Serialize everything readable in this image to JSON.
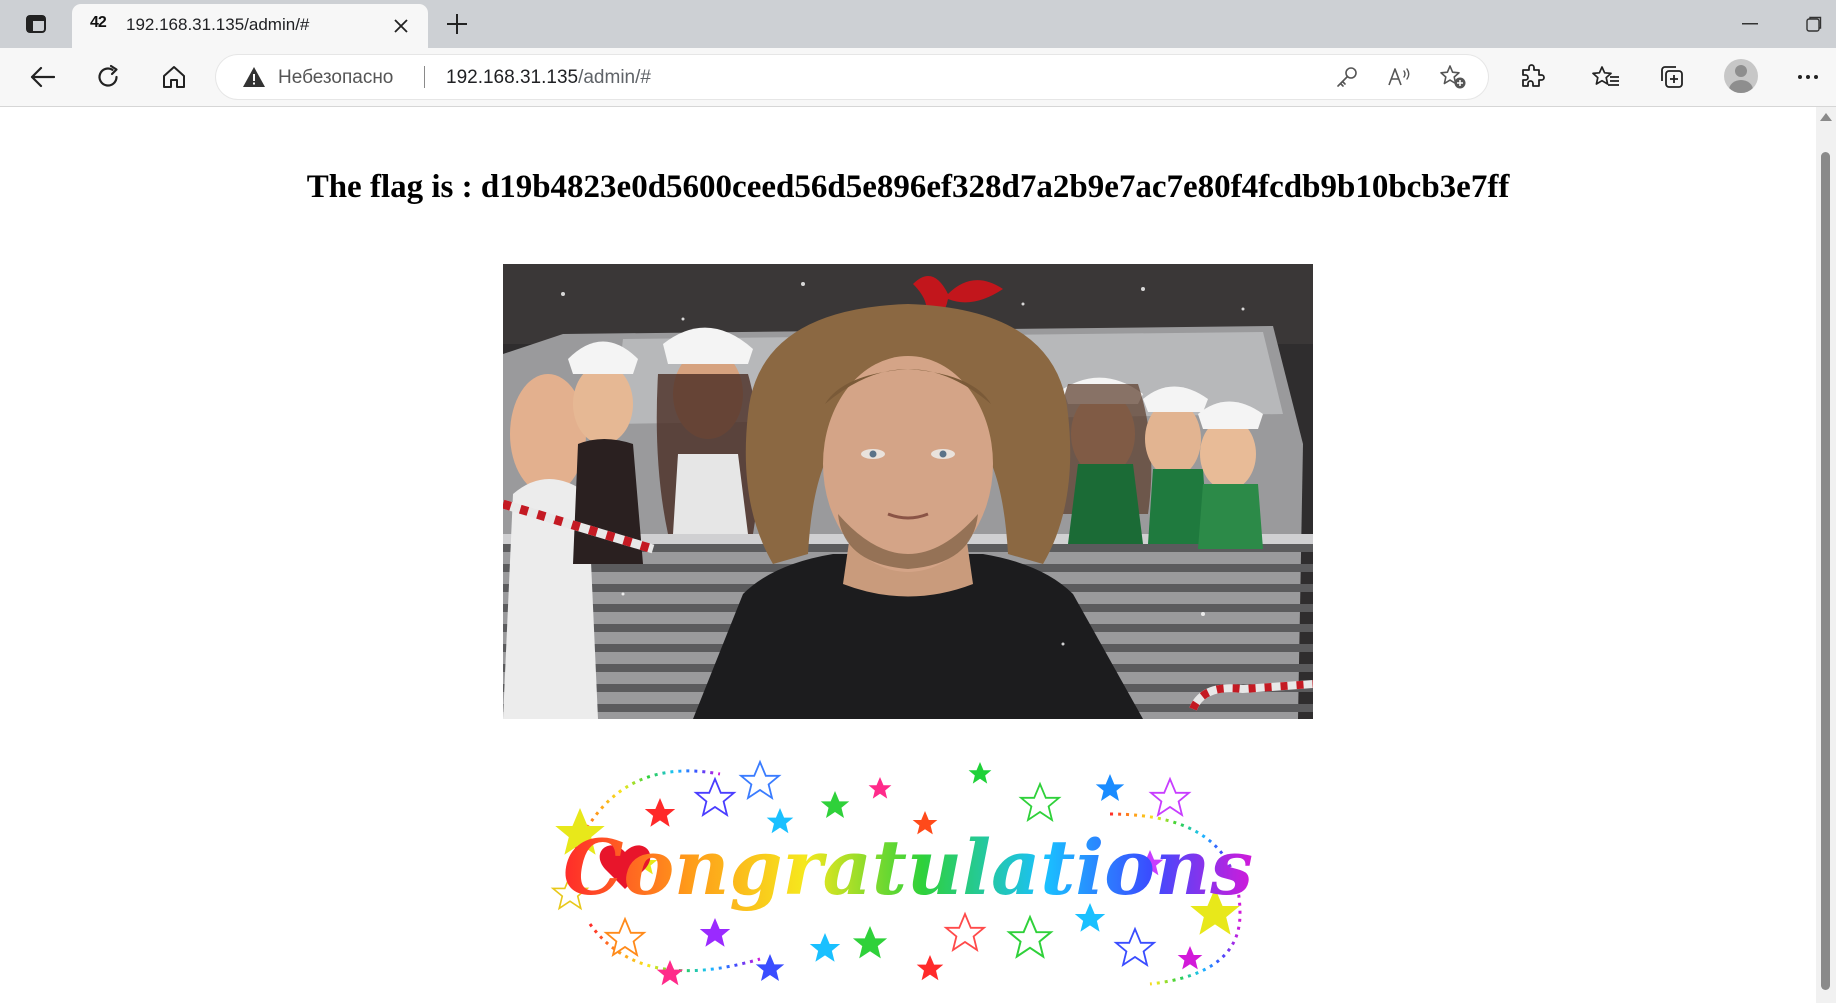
{
  "browser": {
    "tab": {
      "favicon": "42",
      "title": "192.168.31.135/admin/#",
      "favicon_icon": "site-favicon"
    },
    "address_bar": {
      "security_label": "Небезопасно",
      "url_host": "192.168.31.135",
      "url_path": "/admin/#"
    },
    "icons": [
      "tab-actions-icon",
      "close-icon",
      "plus-icon",
      "minimize-icon",
      "maximize-icon",
      "back-arrow-icon",
      "reload-icon",
      "home-icon",
      "warning-icon",
      "key-icon",
      "read-aloud-icon",
      "favorite-add-icon",
      "extensions-icon",
      "favorites-icon",
      "collections-icon",
      "profile-icon",
      "more-icon"
    ]
  },
  "page": {
    "flag_text": "The flag is : d19b4823e0d5600ceed56d5e896ef328d7a2b9e7ac7e80f4fcdb9b10bcb3e7ff",
    "congrats_text": "Congratulations"
  },
  "colors": {
    "tabstrip": "#cdd0d4",
    "toolbar": "#f7f7f7",
    "scrollbar_thumb": "#8a8a8a"
  }
}
